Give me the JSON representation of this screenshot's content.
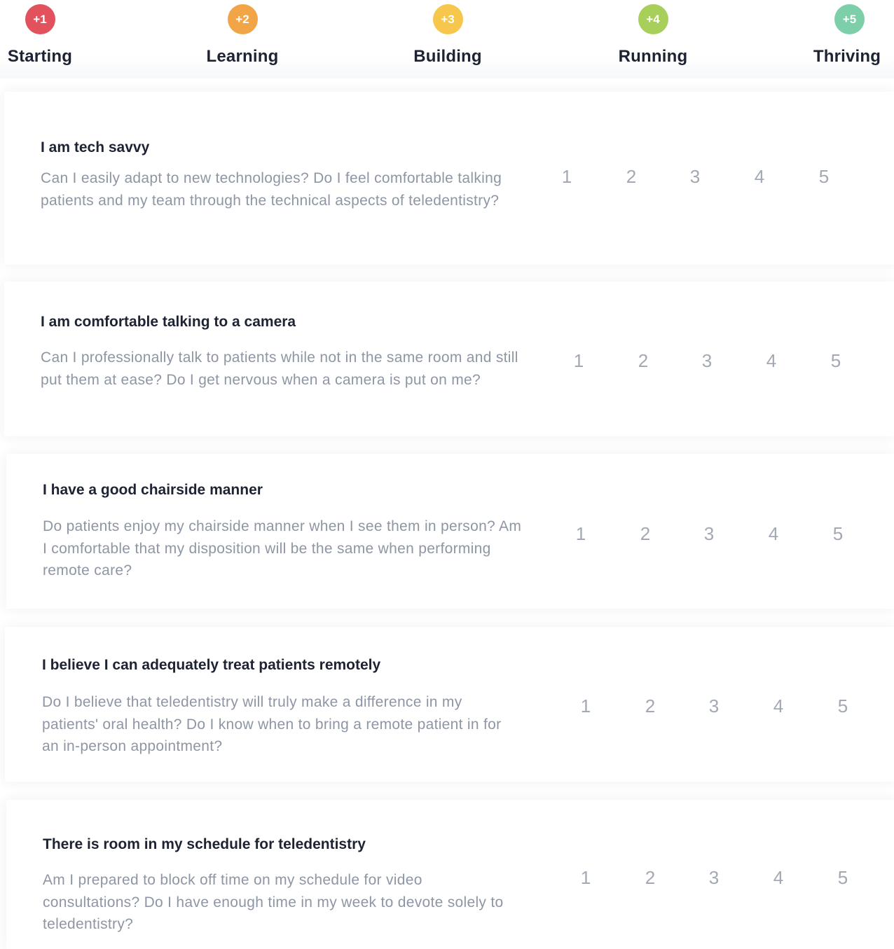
{
  "levels": [
    {
      "badge": "+1",
      "name": "Starting",
      "color": "#e2525c"
    },
    {
      "badge": "+2",
      "name": "Learning",
      "color": "#f2a546"
    },
    {
      "badge": "+3",
      "name": "Building",
      "color": "#f7c64c"
    },
    {
      "badge": "+4",
      "name": "Running",
      "color": "#a8cf5a"
    },
    {
      "badge": "+5",
      "name": "Thriving",
      "color": "#7dcfa9"
    }
  ],
  "questions": [
    {
      "title": "I am tech savvy",
      "description": "Can I easily adapt to new technologies? Do I feel comfortable talking patients and my team through the technical aspects of teledentistry?",
      "options": [
        "1",
        "2",
        "3",
        "4",
        "5"
      ]
    },
    {
      "title": "I am comfortable talking to a camera",
      "description": "Can I professionally talk to patients while not in the same room and still put them at ease? Do I get nervous when a camera is put on me?",
      "options": [
        "1",
        "2",
        "3",
        "4",
        "5"
      ]
    },
    {
      "title": "I have a good chairside manner",
      "description": "Do patients enjoy my chairside manner when I see them in person? Am I comfortable that my disposition will be the same when performing remote care?",
      "options": [
        "1",
        "2",
        "3",
        "4",
        "5"
      ]
    },
    {
      "title": "I believe I can adequately treat patients remotely",
      "description": "Do I believe that teledentistry will truly make a difference in my patients' oral health? Do I know when to bring a remote patient in for an in-person appointment?",
      "options": [
        "1",
        "2",
        "3",
        "4",
        "5"
      ]
    },
    {
      "title": "There is room in my schedule for teledentistry",
      "description": "Am I prepared to block off time on my schedule for video consultations? Do I have enough time in my week to devote solely to teledentistry?",
      "options": [
        "1",
        "2",
        "3",
        "4",
        "5"
      ]
    }
  ]
}
